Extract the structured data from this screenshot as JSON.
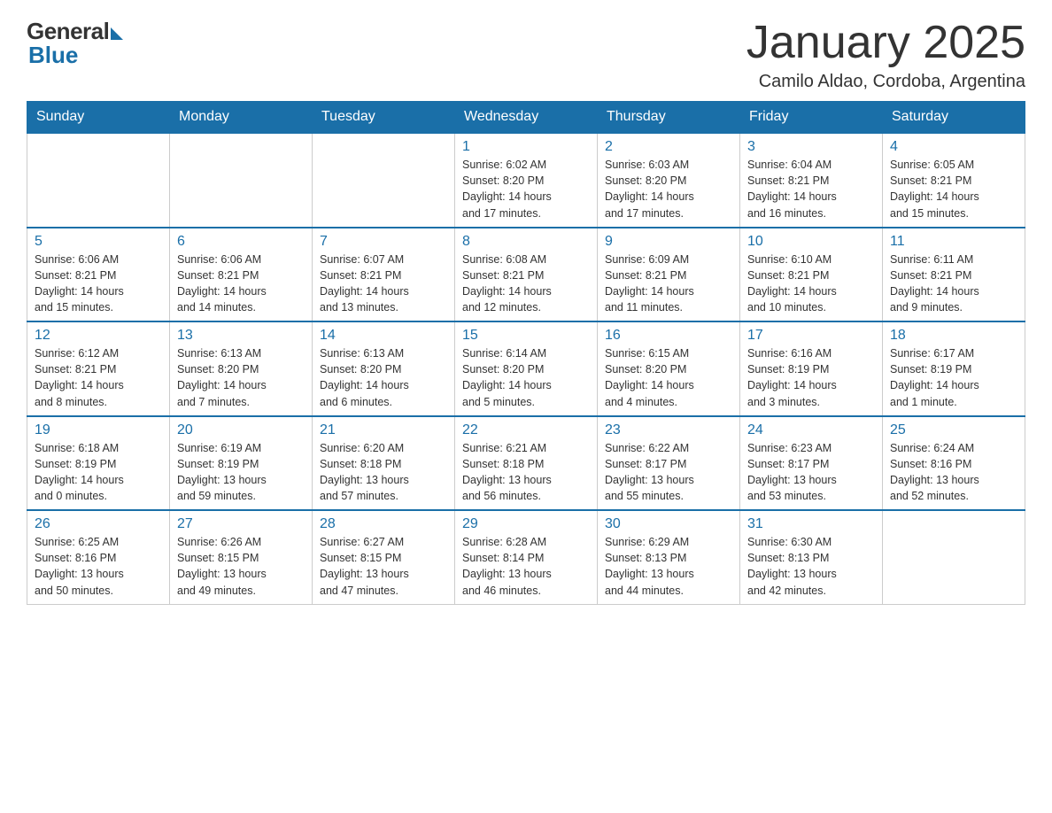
{
  "logo": {
    "general": "General",
    "blue": "Blue"
  },
  "header": {
    "title": "January 2025",
    "subtitle": "Camilo Aldao, Cordoba, Argentina"
  },
  "calendar": {
    "days_of_week": [
      "Sunday",
      "Monday",
      "Tuesday",
      "Wednesday",
      "Thursday",
      "Friday",
      "Saturday"
    ],
    "weeks": [
      [
        {
          "day": "",
          "info": ""
        },
        {
          "day": "",
          "info": ""
        },
        {
          "day": "",
          "info": ""
        },
        {
          "day": "1",
          "info": "Sunrise: 6:02 AM\nSunset: 8:20 PM\nDaylight: 14 hours\nand 17 minutes."
        },
        {
          "day": "2",
          "info": "Sunrise: 6:03 AM\nSunset: 8:20 PM\nDaylight: 14 hours\nand 17 minutes."
        },
        {
          "day": "3",
          "info": "Sunrise: 6:04 AM\nSunset: 8:21 PM\nDaylight: 14 hours\nand 16 minutes."
        },
        {
          "day": "4",
          "info": "Sunrise: 6:05 AM\nSunset: 8:21 PM\nDaylight: 14 hours\nand 15 minutes."
        }
      ],
      [
        {
          "day": "5",
          "info": "Sunrise: 6:06 AM\nSunset: 8:21 PM\nDaylight: 14 hours\nand 15 minutes."
        },
        {
          "day": "6",
          "info": "Sunrise: 6:06 AM\nSunset: 8:21 PM\nDaylight: 14 hours\nand 14 minutes."
        },
        {
          "day": "7",
          "info": "Sunrise: 6:07 AM\nSunset: 8:21 PM\nDaylight: 14 hours\nand 13 minutes."
        },
        {
          "day": "8",
          "info": "Sunrise: 6:08 AM\nSunset: 8:21 PM\nDaylight: 14 hours\nand 12 minutes."
        },
        {
          "day": "9",
          "info": "Sunrise: 6:09 AM\nSunset: 8:21 PM\nDaylight: 14 hours\nand 11 minutes."
        },
        {
          "day": "10",
          "info": "Sunrise: 6:10 AM\nSunset: 8:21 PM\nDaylight: 14 hours\nand 10 minutes."
        },
        {
          "day": "11",
          "info": "Sunrise: 6:11 AM\nSunset: 8:21 PM\nDaylight: 14 hours\nand 9 minutes."
        }
      ],
      [
        {
          "day": "12",
          "info": "Sunrise: 6:12 AM\nSunset: 8:21 PM\nDaylight: 14 hours\nand 8 minutes."
        },
        {
          "day": "13",
          "info": "Sunrise: 6:13 AM\nSunset: 8:20 PM\nDaylight: 14 hours\nand 7 minutes."
        },
        {
          "day": "14",
          "info": "Sunrise: 6:13 AM\nSunset: 8:20 PM\nDaylight: 14 hours\nand 6 minutes."
        },
        {
          "day": "15",
          "info": "Sunrise: 6:14 AM\nSunset: 8:20 PM\nDaylight: 14 hours\nand 5 minutes."
        },
        {
          "day": "16",
          "info": "Sunrise: 6:15 AM\nSunset: 8:20 PM\nDaylight: 14 hours\nand 4 minutes."
        },
        {
          "day": "17",
          "info": "Sunrise: 6:16 AM\nSunset: 8:19 PM\nDaylight: 14 hours\nand 3 minutes."
        },
        {
          "day": "18",
          "info": "Sunrise: 6:17 AM\nSunset: 8:19 PM\nDaylight: 14 hours\nand 1 minute."
        }
      ],
      [
        {
          "day": "19",
          "info": "Sunrise: 6:18 AM\nSunset: 8:19 PM\nDaylight: 14 hours\nand 0 minutes."
        },
        {
          "day": "20",
          "info": "Sunrise: 6:19 AM\nSunset: 8:19 PM\nDaylight: 13 hours\nand 59 minutes."
        },
        {
          "day": "21",
          "info": "Sunrise: 6:20 AM\nSunset: 8:18 PM\nDaylight: 13 hours\nand 57 minutes."
        },
        {
          "day": "22",
          "info": "Sunrise: 6:21 AM\nSunset: 8:18 PM\nDaylight: 13 hours\nand 56 minutes."
        },
        {
          "day": "23",
          "info": "Sunrise: 6:22 AM\nSunset: 8:17 PM\nDaylight: 13 hours\nand 55 minutes."
        },
        {
          "day": "24",
          "info": "Sunrise: 6:23 AM\nSunset: 8:17 PM\nDaylight: 13 hours\nand 53 minutes."
        },
        {
          "day": "25",
          "info": "Sunrise: 6:24 AM\nSunset: 8:16 PM\nDaylight: 13 hours\nand 52 minutes."
        }
      ],
      [
        {
          "day": "26",
          "info": "Sunrise: 6:25 AM\nSunset: 8:16 PM\nDaylight: 13 hours\nand 50 minutes."
        },
        {
          "day": "27",
          "info": "Sunrise: 6:26 AM\nSunset: 8:15 PM\nDaylight: 13 hours\nand 49 minutes."
        },
        {
          "day": "28",
          "info": "Sunrise: 6:27 AM\nSunset: 8:15 PM\nDaylight: 13 hours\nand 47 minutes."
        },
        {
          "day": "29",
          "info": "Sunrise: 6:28 AM\nSunset: 8:14 PM\nDaylight: 13 hours\nand 46 minutes."
        },
        {
          "day": "30",
          "info": "Sunrise: 6:29 AM\nSunset: 8:13 PM\nDaylight: 13 hours\nand 44 minutes."
        },
        {
          "day": "31",
          "info": "Sunrise: 6:30 AM\nSunset: 8:13 PM\nDaylight: 13 hours\nand 42 minutes."
        },
        {
          "day": "",
          "info": ""
        }
      ]
    ]
  }
}
